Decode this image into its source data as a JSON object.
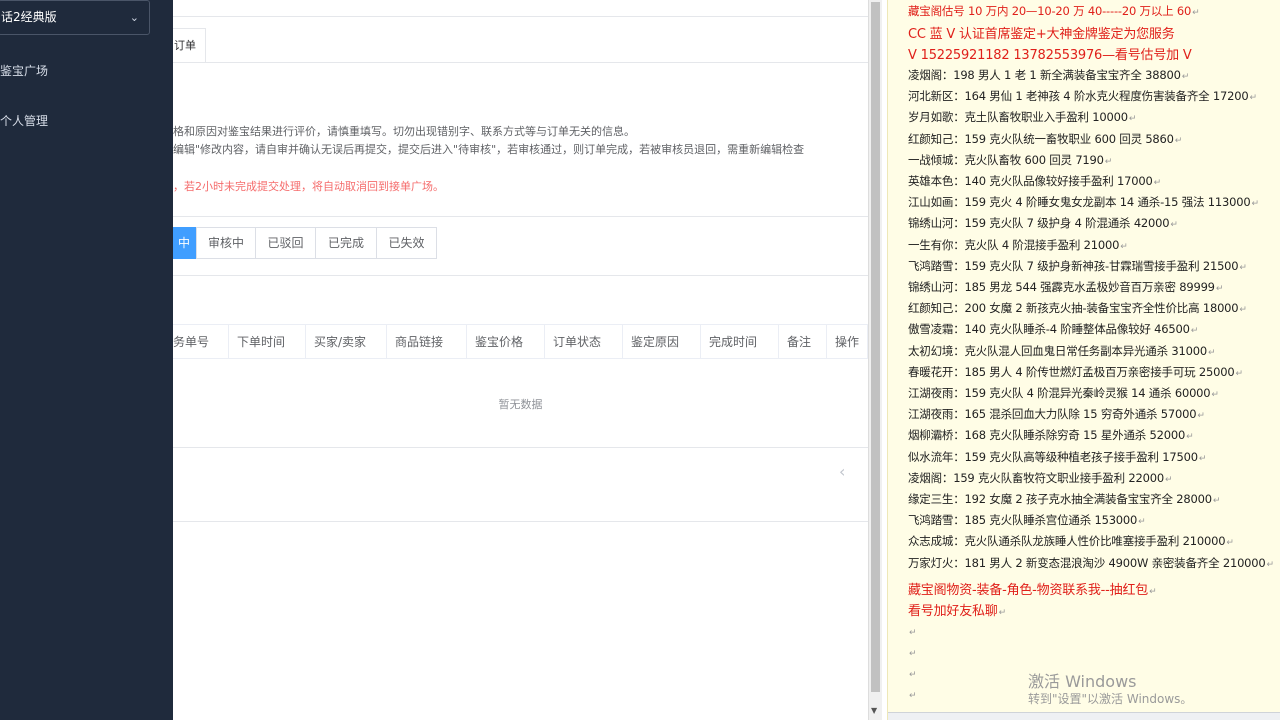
{
  "sidebar": {
    "game_select": "话2经典版",
    "nav": [
      {
        "label": "鉴宝广场"
      },
      {
        "label": "个人管理"
      }
    ]
  },
  "main": {
    "order_tab": "订单",
    "notices": [
      "格和原因对鉴宝结果进行评价，请慎重填写。切勿出现错别字、联系方式等与订单无关的信息。",
      "编辑\"修改内容，请自审并确认无误后再提交，提交后进入\"待审核\"，若审核通过，则订单完成，若被审核员退回，需重新编辑检查",
      "，若2小时未完成提交处理，将自动取消回到接单广场。"
    ],
    "status_tabs": [
      {
        "label": "中",
        "active": true
      },
      {
        "label": "审核中",
        "active": false
      },
      {
        "label": "已驳回",
        "active": false
      },
      {
        "label": "已完成",
        "active": false
      },
      {
        "label": "已失效",
        "active": false
      }
    ],
    "table_headers": [
      "务单号",
      "下单时间",
      "买家/卖家",
      "商品链接",
      "鉴宝价格",
      "订单状态",
      "鉴定原因",
      "完成时间",
      "备注",
      "操作"
    ],
    "empty_text": "暂无数据",
    "pager_prev": "‹"
  },
  "doc": {
    "header_lines": [
      "藏宝阁估号 10 万内 20—10-20 万 40-----20 万以上 60",
      "CC 蓝 V 认证首席鉴定+大神金牌鉴定为您服务",
      "V 15225921182      13782553976—看号估号加 V"
    ],
    "lines": [
      "凌烟阁：198 男人 1 老 1 新全满装备宝宝齐全 38800",
      "河北新区：164 男仙 1 老神孩 4 阶水克火程度伤害装备齐全 17200",
      "岁月如歌：克土队畜牧职业入手盈利 10000",
      "红颜知己：159 克火队统一畜牧职业 600 回灵 5860",
      "一战倾城：克火队畜牧 600 回灵 7190",
      "英雄本色：140 克火队品像较好接手盈利 17000",
      "江山如画：159 克火 4 阶睡女鬼女龙副本 14 通杀-15 强法 113000",
      "锦绣山河：159 克火队 7 级护身 4 阶混通杀 42000",
      "一生有你：克火队 4 阶混接手盈利 21000",
      "飞鸿踏雪：159 克火队 7 级护身新神孩-甘霖瑞雪接手盈利 21500",
      "锦绣山河：185 男龙 544 强霹克水孟极妙音百万亲密 89999",
      "红颜知己：200 女魔 2 新孩克火抽-装备宝宝齐全性价比高 18000",
      "傲雪凌霜：140 克火队睡杀-4 阶睡整体品像较好 46500",
      "太初幻境：克火队混人回血鬼日常任务副本异光通杀 31000",
      "春暖花开：185 男人 4 阶传世燃灯孟极百万亲密接手可玩 25000",
      "江湖夜雨：159 克火队 4 阶混异光秦岭灵猴 14 通杀 60000",
      "江湖夜雨：165 混杀回血大力队除 15 穷奇外通杀 57000",
      "烟柳灞桥：168 克火队睡杀除穷奇 15 星外通杀 52000",
      "似水流年：159 克火队高等级种植老孩子接手盈利 17500",
      "凌烟阁：159 克火队畜牧符文职业接手盈利 22000",
      "缘定三生：192 女魔 2 孩子克水抽全满装备宝宝齐全 28000",
      "飞鸿踏雪：185 克火队睡杀宫位通杀 153000",
      "众志成城：克火队通杀队龙族睡人性价比唯塞接手盈利 210000",
      "万家灯火：181 男人 2 新变态混浪淘沙 4900W 亲密装备齐全 210000"
    ],
    "footer_lines": [
      "藏宝阁物资-装备-角色-物资联系我--抽红包",
      "看号加好友私聊"
    ],
    "watermark_1": "激活 Windows",
    "watermark_2": "转到\"设置\"以激活 Windows。"
  }
}
